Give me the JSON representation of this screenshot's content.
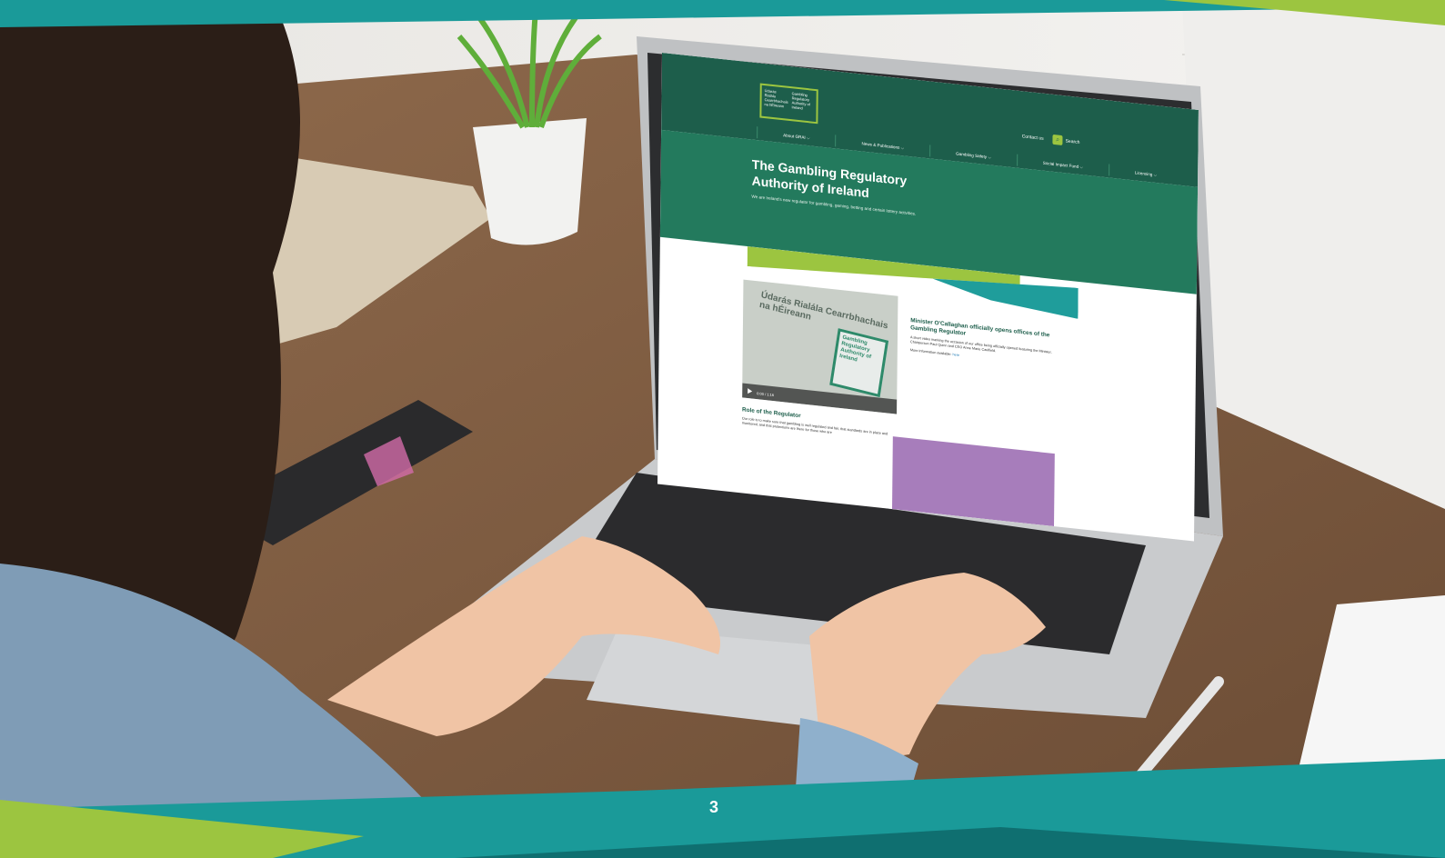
{
  "site": {
    "logo": {
      "irish": "Údarás Rialála Cearrbhachais na hÉireann",
      "english": "Gambling Regulatory Authority of Ireland"
    },
    "top_links": {
      "contact": "Contact us",
      "search": "Search"
    },
    "nav": [
      "About GRAI ⌵",
      "News & Publications ⌵",
      "Gambling Safety ⌵",
      "Social Impact Fund ⌵",
      "Licensing ⌵"
    ],
    "hero": {
      "title": "The Gambling Regulatory Authority of Ireland",
      "subtitle": "We are Ireland's new regulator for gambling, gaming, betting and certain lottery activities."
    },
    "video": {
      "sign_irish": "Údarás Rialála Cearrbhachais na hÉireann",
      "sign_english": "Gambling Regulatory Authority of Ireland",
      "time": "0:00 / 1:16"
    },
    "news": {
      "title": "Minister O'Callaghan officially opens offices of the Gambling Regulator",
      "body": "A short video marking the occasion of our office being officially opened featuring the Minister, Chairperson Paul Quinn and CEO Anne Marie Caulfield.",
      "more_prefix": "More information available:",
      "more_link": "here"
    },
    "role": {
      "title": "Role of the Regulator",
      "body": "Our role is to make sure that gambling is well regulated and fair, that standards are in place and monitored, and that protections are there for those who are"
    }
  },
  "page_number": "3",
  "colors": {
    "dark_green": "#1d5e4b",
    "hero_green": "#237a5d",
    "lime": "#9cc540",
    "teal": "#1f9d9b",
    "purple": "#a77dbb"
  }
}
